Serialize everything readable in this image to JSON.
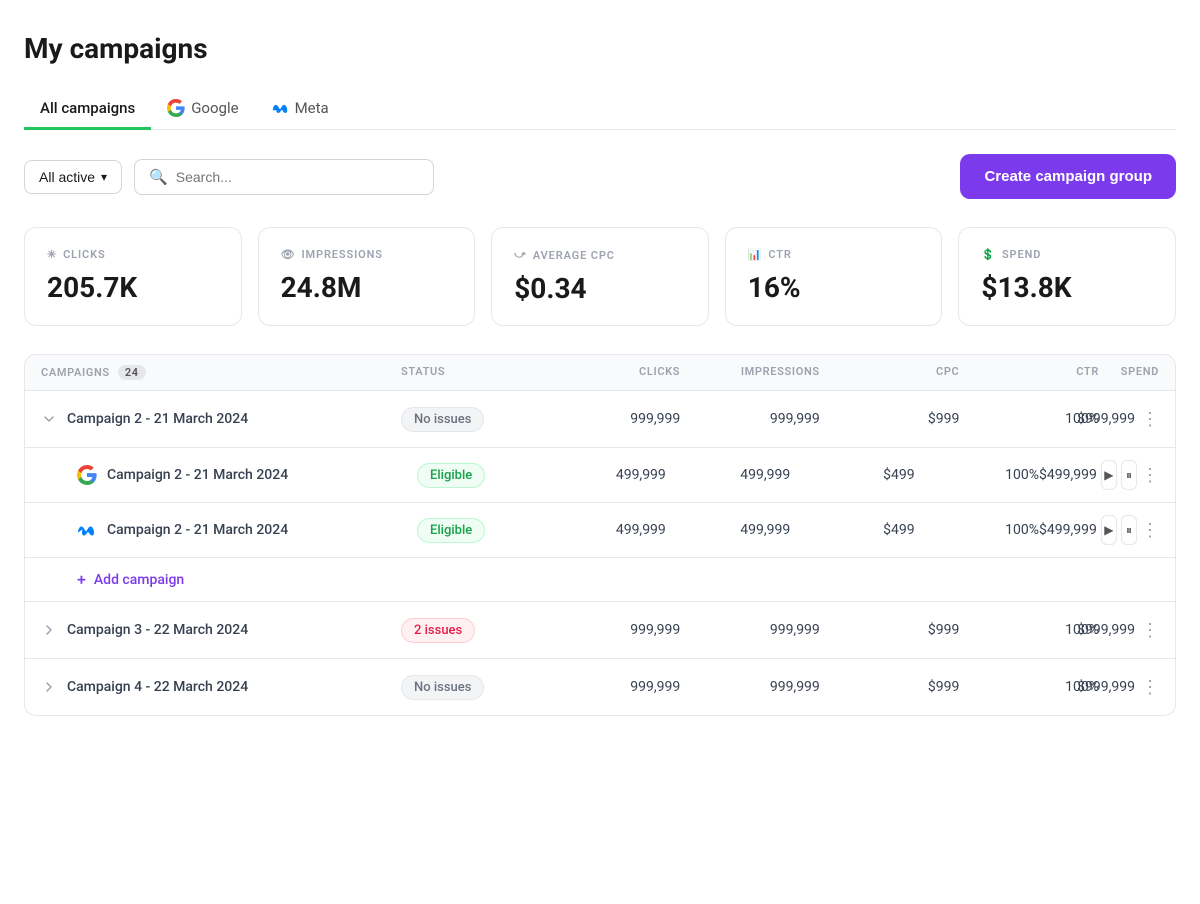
{
  "page": {
    "title": "My campaigns"
  },
  "tabs": [
    {
      "id": "all",
      "label": "All campaigns",
      "active": true
    },
    {
      "id": "google",
      "label": "Google",
      "active": false
    },
    {
      "id": "meta",
      "label": "Meta",
      "active": false
    }
  ],
  "toolbar": {
    "filter_label": "All active",
    "search_placeholder": "Search...",
    "create_button_label": "Create campaign group"
  },
  "metrics": [
    {
      "id": "clicks",
      "label": "CLICKS",
      "value": "205.7K",
      "icon": "sparkle"
    },
    {
      "id": "impressions",
      "label": "IMPRESSIONS",
      "value": "24.8M",
      "icon": "eye"
    },
    {
      "id": "avg_cpc",
      "label": "AVERAGE CPC",
      "value": "$0.34",
      "icon": "cursor"
    },
    {
      "id": "ctr",
      "label": "CTR",
      "value": "16%",
      "icon": "chart"
    },
    {
      "id": "spend",
      "label": "SPEND",
      "value": "$13.8K",
      "icon": "money"
    }
  ],
  "table": {
    "headers": {
      "campaigns": "CAMPAIGNS",
      "count": "24",
      "status": "STATUS",
      "clicks": "CLICKS",
      "impressions": "IMPRESSIONS",
      "cpc": "CPC",
      "ctr": "CTR",
      "spend": "SPEND"
    },
    "rows": [
      {
        "id": "row1",
        "name": "Campaign 2 - 21 March 2024",
        "status": "No issues",
        "status_type": "neutral",
        "clicks": "999,999",
        "impressions": "999,999",
        "cpc": "$999",
        "ctr": "100%",
        "spend": "$999,999",
        "expanded": true,
        "sub_rows": [
          {
            "id": "sub1a",
            "platform": "google",
            "name": "Campaign 2 - 21 March 2024",
            "status": "Eligible",
            "status_type": "green",
            "clicks": "499,999",
            "impressions": "499,999",
            "cpc": "$499",
            "ctr": "100%",
            "spend": "$499,999"
          },
          {
            "id": "sub1b",
            "platform": "meta",
            "name": "Campaign 2 - 21 March 2024",
            "status": "Eligible",
            "status_type": "green",
            "clicks": "499,999",
            "impressions": "499,999",
            "cpc": "$499",
            "ctr": "100%",
            "spend": "$499,999"
          }
        ]
      },
      {
        "id": "row2",
        "name": "Campaign 3 - 22 March 2024",
        "status": "2 issues",
        "status_type": "red",
        "clicks": "999,999",
        "impressions": "999,999",
        "cpc": "$999",
        "ctr": "100%",
        "spend": "$999,999",
        "expanded": false
      },
      {
        "id": "row3",
        "name": "Campaign 4 - 22 March 2024",
        "status": "No issues",
        "status_type": "neutral",
        "clicks": "999,999",
        "impressions": "999,999",
        "cpc": "$999",
        "ctr": "100%",
        "spend": "$999,999",
        "expanded": false
      }
    ],
    "add_campaign_label": "Add campaign"
  }
}
